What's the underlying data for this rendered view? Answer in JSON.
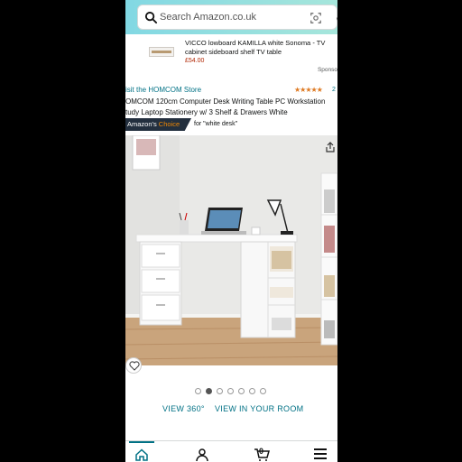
{
  "search": {
    "placeholder": "Search Amazon.co.uk"
  },
  "sponsored_ad": {
    "title": "VICCO lowboard KAMILLA white Sonoma - TV cabinet sideboard shelf TV table",
    "price": "£54.00",
    "sponsored_label": "Sponso"
  },
  "product": {
    "store_link": "isit the HOMCOM Store",
    "stars": "★★★★★",
    "rating_count": "2",
    "title": "OMCOM 120cm Computer Desk Writing Table PC Workstation tudy Laptop Stationery w/ 3 Shelf & Drawers White",
    "badge_prefix": "Amazon's ",
    "badge_accent": "Choice",
    "badge_for": "for \"white desk\""
  },
  "gallery": {
    "dot_count": 7,
    "active_index": 1
  },
  "views": {
    "view_360": "VIEW 360°",
    "view_room": "VIEW IN YOUR ROOM"
  },
  "bottom_nav": {
    "cart_count": "0",
    "icons": [
      "home-icon",
      "account-icon",
      "cart-icon",
      "menu-icon"
    ]
  },
  "colors": {
    "link": "#007185",
    "price": "#b12704",
    "badge_bg": "#232f3e",
    "badge_accent": "#f08804",
    "header_gradient": [
      "#82d8e3",
      "#a6e6db"
    ]
  }
}
